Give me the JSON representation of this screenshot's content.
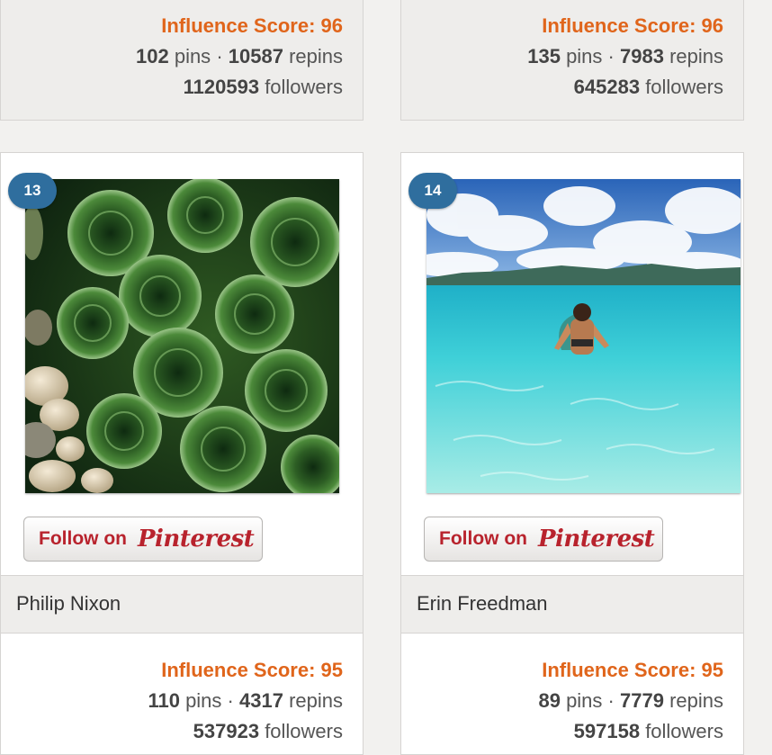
{
  "cards_top": [
    {
      "influence": "Influence Score: 96",
      "pins": "102",
      "pins_label": "pins",
      "sep": "·",
      "repins": "10587",
      "repins_label": "repins",
      "followers": "1120593",
      "followers_label": "followers"
    },
    {
      "influence": "Influence Score: 96",
      "pins": "135",
      "pins_label": "pins",
      "sep": "·",
      "repins": "7983",
      "repins_label": "repins",
      "followers": "645283",
      "followers_label": "followers"
    }
  ],
  "cards": [
    {
      "rank": "13",
      "image": "succulent-plants-photo",
      "follow_label": "Follow on",
      "brand": "Pinterest",
      "name": "Philip Nixon",
      "influence": "Influence Score: 95",
      "pins": "110",
      "pins_label": "pins",
      "sep": "·",
      "repins": "4317",
      "repins_label": "repins",
      "followers": "537923",
      "followers_label": "followers"
    },
    {
      "rank": "14",
      "image": "woman-in-turquoise-sea-photo",
      "follow_label": "Follow on",
      "brand": "Pinterest",
      "name": "Erin Freedman",
      "influence": "Influence Score: 95",
      "pins": "89",
      "pins_label": "pins",
      "sep": "·",
      "repins": "7779",
      "repins_label": "repins",
      "followers": "597158",
      "followers_label": "followers"
    }
  ],
  "colors": {
    "score": "#e0651b",
    "brand": "#b8232d",
    "badge": "#2f6e9e"
  }
}
